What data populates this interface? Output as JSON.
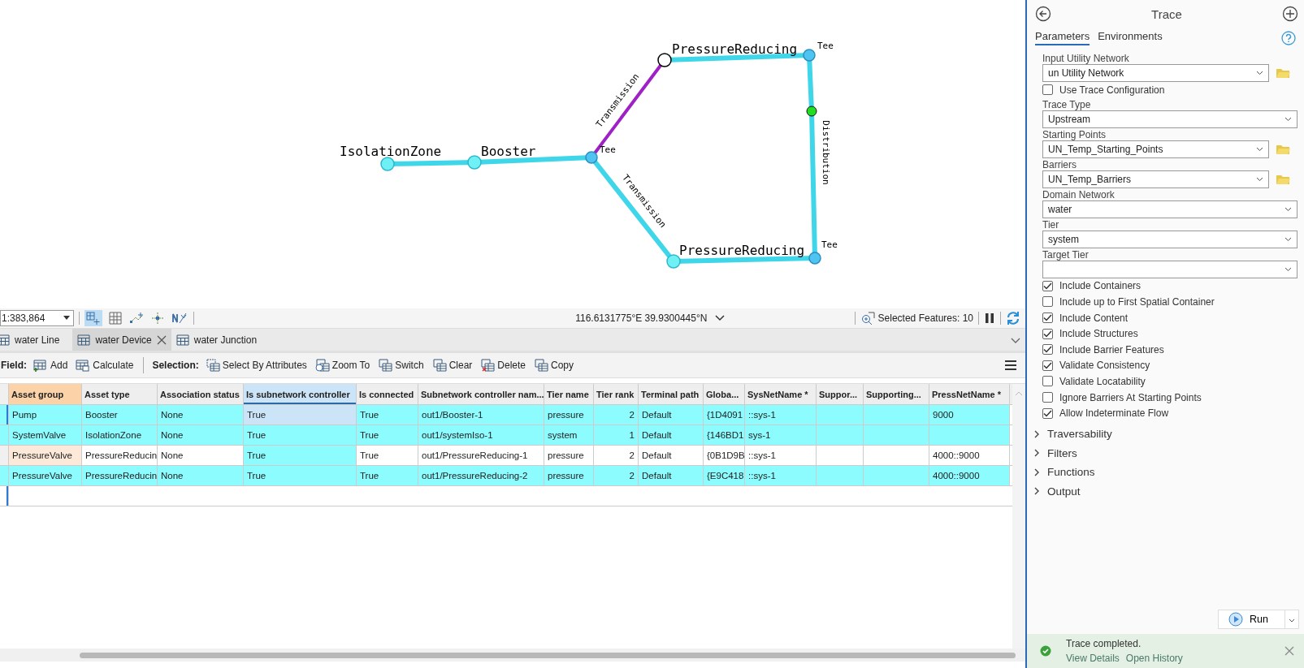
{
  "map": {
    "nodes": [
      {
        "label": "IsolationZone",
        "kind": "device",
        "traced": true
      },
      {
        "label": "Booster",
        "kind": "device",
        "traced": true
      },
      {
        "label": "Tee",
        "kind": "junction",
        "traced": true
      },
      {
        "label": "PressureReducing",
        "kind": "device",
        "traced": false
      },
      {
        "label": "Tee",
        "kind": "junction",
        "traced": true
      },
      {
        "kind": "start",
        "traced": true
      },
      {
        "label": "PressureReducing",
        "kind": "device",
        "traced": true
      },
      {
        "label": "Tee",
        "kind": "junction",
        "traced": true
      }
    ],
    "edges": [
      {
        "traced": true
      },
      {
        "traced": true
      },
      {
        "label": "Transmission",
        "traced": false
      },
      {
        "traced": true
      },
      {
        "label": "Distribution",
        "traced": true
      },
      {
        "traced": true
      },
      {
        "label": "Transmission",
        "traced": true
      },
      {
        "traced": true
      }
    ]
  },
  "status_bar": {
    "scale": "1:383,864",
    "coordinates": "116.6131775°E 39.9300445°N",
    "selected_features": "Selected Features: 10"
  },
  "tabs": [
    {
      "label": "water Line",
      "selected": false
    },
    {
      "label": "water Device",
      "selected": true
    },
    {
      "label": "water Junction",
      "selected": false
    }
  ],
  "toolbar": {
    "field_label": "Field:",
    "field_buttons": [
      "Add",
      "Calculate"
    ],
    "selection_label": "Selection:",
    "selection_buttons": [
      "Select By Attributes",
      "Zoom To",
      "Switch",
      "Clear",
      "Delete",
      "Copy"
    ]
  },
  "table": {
    "columns": [
      {
        "label": "Asset group",
        "highlighted": true,
        "selected": false
      },
      {
        "label": "Asset type",
        "highlighted": false,
        "selected": false
      },
      {
        "label": "Association status",
        "highlighted": false,
        "selected": false
      },
      {
        "label": "Is subnetwork controller",
        "highlighted": false,
        "selected": true
      },
      {
        "label": "Is connected",
        "highlighted": false,
        "selected": false
      },
      {
        "label": "Subnetwork controller nam...",
        "highlighted": false,
        "selected": false
      },
      {
        "label": "Tier name",
        "highlighted": false,
        "selected": false
      },
      {
        "label": "Tier rank",
        "highlighted": false,
        "selected": false
      },
      {
        "label": "Terminal path",
        "highlighted": false,
        "selected": false
      },
      {
        "label": "Globa...",
        "highlighted": false,
        "selected": false
      },
      {
        "label": "SysNetName *",
        "highlighted": false,
        "selected": false
      },
      {
        "label": "Suppor...",
        "highlighted": false,
        "selected": false
      },
      {
        "label": "Supporting...",
        "highlighted": false,
        "selected": false
      },
      {
        "label": "PressNetName *",
        "highlighted": false,
        "selected": false
      }
    ],
    "rows": [
      {
        "selected": true,
        "focused": true,
        "cells": [
          "Pump",
          "Booster",
          "None",
          "True",
          "True",
          "out1/Booster-1",
          "pressure",
          "2",
          "Default",
          "{1D4091",
          "::sys-1",
          "",
          "",
          "9000"
        ]
      },
      {
        "selected": true,
        "focused": false,
        "cells": [
          "SystemValve",
          "IsolationZone",
          "None",
          "True",
          "True",
          "out1/systemIso-1",
          "system",
          "1",
          "Default",
          "{146BD1",
          "sys-1",
          "",
          "",
          ""
        ]
      },
      {
        "selected": false,
        "focused": false,
        "cells": [
          "PressureValve",
          "PressureReducin",
          "None",
          "True",
          "True",
          "out1/PressureReducing-1",
          "pressure",
          "2",
          "Default",
          "{0B1D9B",
          "::sys-1",
          "",
          "",
          "4000::9000"
        ]
      },
      {
        "selected": true,
        "focused": false,
        "cells": [
          "PressureValve",
          "PressureReducin",
          "None",
          "True",
          "True",
          "out1/PressureReducing-2",
          "pressure",
          "2",
          "Default",
          "{E9C418",
          "::sys-1",
          "",
          "",
          "4000::9000"
        ]
      }
    ]
  },
  "pane": {
    "title": "Trace",
    "tabs": [
      {
        "label": "Parameters",
        "selected": true
      },
      {
        "label": "Environments",
        "selected": false
      }
    ],
    "params": [
      {
        "kind": "select",
        "label": "Input Utility Network",
        "value": "un Utility Network",
        "browse": true
      },
      {
        "kind": "checkbox",
        "label": "Use Trace Configuration",
        "checked": false
      },
      {
        "kind": "select",
        "label": "Trace Type",
        "value": "Upstream"
      },
      {
        "kind": "select",
        "label": "Starting Points",
        "value": "UN_Temp_Starting_Points",
        "browse": true
      },
      {
        "kind": "select",
        "label": "Barriers",
        "value": "UN_Temp_Barriers",
        "browse": true
      },
      {
        "kind": "select",
        "label": "Domain Network",
        "value": "water"
      },
      {
        "kind": "select",
        "label": "Tier",
        "value": "system"
      },
      {
        "kind": "select",
        "label": "Target Tier"
      },
      {
        "kind": "checkbox",
        "label": "Include Containers",
        "checked": true
      },
      {
        "kind": "checkbox",
        "label": "Include up to First Spatial Container",
        "checked": false
      },
      {
        "kind": "checkbox",
        "label": "Include Content",
        "checked": true
      },
      {
        "kind": "checkbox",
        "label": "Include Structures",
        "checked": true
      },
      {
        "kind": "checkbox",
        "label": "Include Barrier Features",
        "checked": true
      },
      {
        "kind": "checkbox",
        "label": "Validate Consistency",
        "checked": true
      },
      {
        "kind": "checkbox",
        "label": "Validate Locatability",
        "checked": false
      },
      {
        "kind": "checkbox",
        "label": "Ignore Barriers At Starting Points",
        "checked": false
      },
      {
        "kind": "checkbox",
        "label": "Allow Indeterminate Flow",
        "checked": true
      }
    ],
    "sections": [
      {
        "label": "Traversability",
        "expanded": false
      },
      {
        "label": "Filters",
        "expanded": false
      },
      {
        "label": "Functions",
        "expanded": false
      },
      {
        "label": "Output",
        "expanded": false
      }
    ],
    "run_button": "Run",
    "message": {
      "text": "Trace completed.",
      "links": [
        "View Details",
        "Open History"
      ]
    }
  }
}
